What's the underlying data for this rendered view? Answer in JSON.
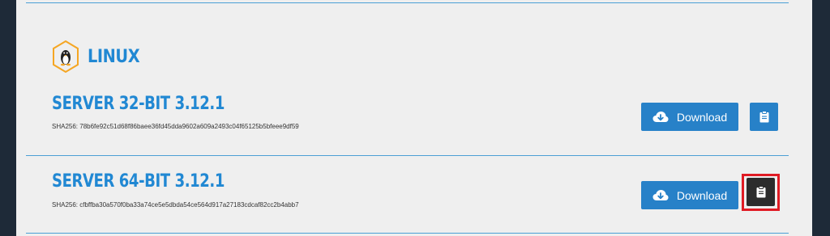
{
  "section": {
    "title": "LINUX",
    "icon": "linux-penguin-icon"
  },
  "releases": [
    {
      "title": "SERVER 32-BIT 3.12.1",
      "sha": "SHA256: 78b6fe92c51d68f86baee36fd45dda9602a609a2493c04f65125b5bfeee9df59",
      "download_label": "Download",
      "copy_icon": "clipboard-icon"
    },
    {
      "title": "SERVER 64-BIT 3.12.1",
      "sha": "SHA256: cfbffba30a570f0ba33a74ce5e5dbda54ce564d917a27183cdcaf82cc2b4abb7",
      "download_label": "Download",
      "copy_icon": "clipboard-icon"
    }
  ],
  "colors": {
    "accent": "#2188d3",
    "button": "#2781c8",
    "highlight_box": "#e01b24",
    "icon_hex": "#f5a623"
  }
}
